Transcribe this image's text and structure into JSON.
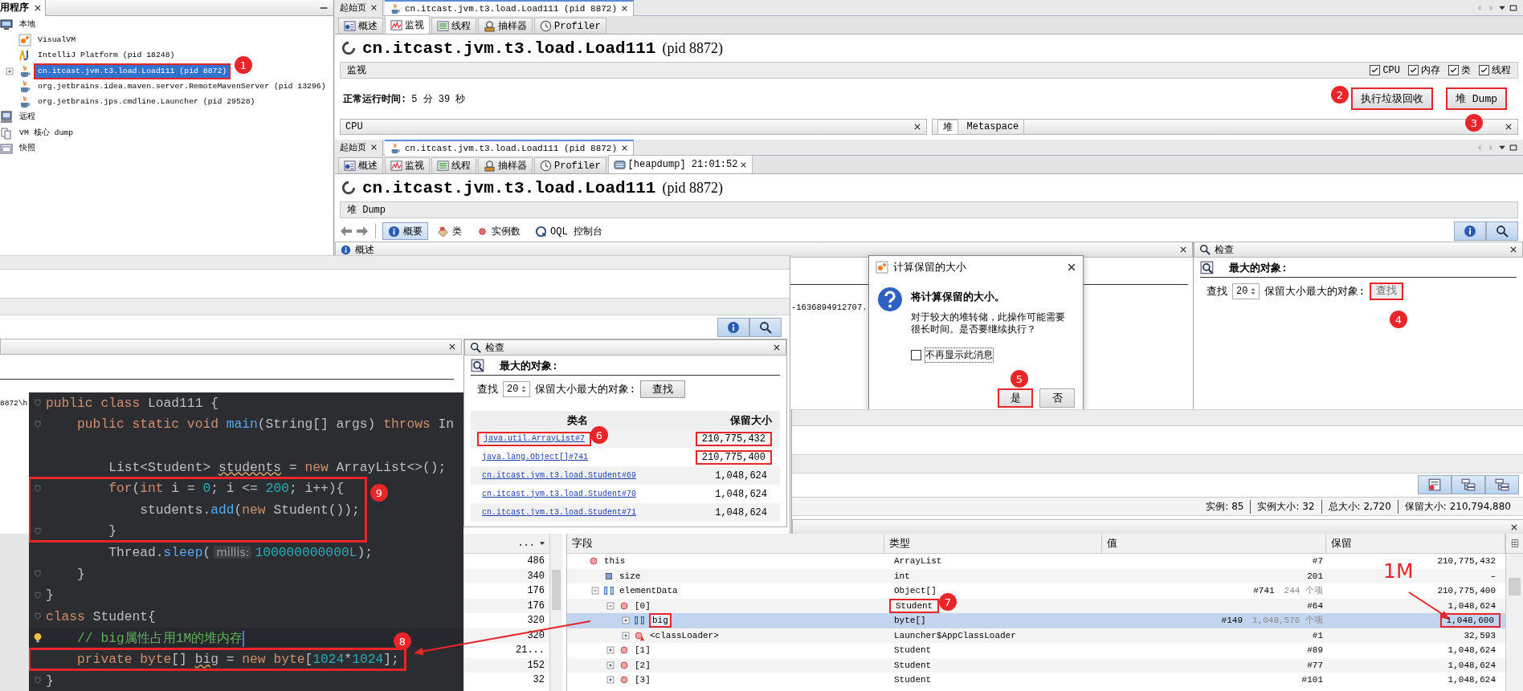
{
  "sidebar": {
    "title": "用程序",
    "items": [
      {
        "label": "本地",
        "selected": false,
        "children": [
          {
            "label": "VisualVM",
            "selected": false,
            "highlighted": false
          },
          {
            "label": "IntelliJ Platform (pid 18248)",
            "selected": false,
            "highlighted": false
          },
          {
            "label": "cn.itcast.jvm.t3.load.Load111 (pid 8872)",
            "selected": true,
            "highlighted": true,
            "expanded": false
          },
          {
            "label": "org.jetbrains.idea.maven.server.RemoteMavenServer (pid 13296)",
            "selected": false,
            "highlighted": false
          },
          {
            "label": "org.jetbrains.jps.cmdline.Launcher (pid 29528)",
            "selected": false,
            "highlighted": false
          }
        ]
      },
      {
        "label": "远程",
        "selected": false
      },
      {
        "label": "VM 核心 dump",
        "selected": false
      },
      {
        "label": "快照",
        "selected": false
      }
    ]
  },
  "monitor_window": {
    "doc_tabs": [
      {
        "label": "起始页",
        "selected": false
      },
      {
        "label": "cn.itcast.jvm.t3.load.Load111 (pid 8872)",
        "selected": true
      }
    ],
    "view_tabs": [
      {
        "label": "概述",
        "selected": false
      },
      {
        "label": "监视",
        "selected": true
      },
      {
        "label": "线程",
        "selected": false
      },
      {
        "label": "抽样器",
        "selected": false
      },
      {
        "label": "Profiler",
        "selected": false
      }
    ],
    "title": "cn.itcast.jvm.t3.load.Load111",
    "pid": "(pid 8872)",
    "section": "监视",
    "checkboxes": [
      {
        "label": "CPU",
        "checked": true
      },
      {
        "label": "内存",
        "checked": true
      },
      {
        "label": "类",
        "checked": true
      },
      {
        "label": "线程",
        "checked": true
      }
    ],
    "uptime_label": "正常运行时间:",
    "uptime": "5 分 39 秒",
    "buttons": [
      {
        "label": "执行垃圾回收",
        "highlighted": true
      },
      {
        "label": "堆 Dump",
        "highlighted": true
      }
    ],
    "cpu_panel": "CPU",
    "memory_tabs": [
      {
        "label": "堆",
        "selected": true
      },
      {
        "label": "Metaspace",
        "selected": false
      }
    ]
  },
  "heapdump_window": {
    "doc_tabs": [
      {
        "label": "起始页",
        "selected": false
      },
      {
        "label": "cn.itcast.jvm.t3.load.Load111 (pid 8872)",
        "selected": true
      }
    ],
    "view_tabs": [
      {
        "label": "概述",
        "selected": false,
        "closable": false
      },
      {
        "label": "监视",
        "selected": false,
        "closable": false
      },
      {
        "label": "线程",
        "selected": false,
        "closable": false
      },
      {
        "label": "抽样器",
        "selected": false,
        "closable": false
      },
      {
        "label": "Profiler",
        "selected": false,
        "closable": false
      },
      {
        "label": "[heapdump] 21:01:52",
        "selected": true,
        "closable": true
      }
    ],
    "title": "cn.itcast.jvm.t3.load.Load111",
    "pid": "(pid 8872)",
    "section": "堆 Dump",
    "toolbar": [
      {
        "label": "概要",
        "selected": true
      },
      {
        "label": "类",
        "selected": false
      },
      {
        "label": "实例数",
        "selected": false
      },
      {
        "label": "OQL 控制台",
        "selected": false
      }
    ],
    "overview_panel": "概述",
    "summary_value": "-1636894912707.",
    "inspect": {
      "title": "检查",
      "heading": "最大的对象:",
      "find_label": "查找",
      "count": "20",
      "suffix": "保留大小最大的对象:",
      "button": "查找",
      "button_disabled": true,
      "button_highlighted": true
    }
  },
  "classes_view": {
    "path_text": "8872\\h",
    "inspect": {
      "title": "检查",
      "heading": "最大的对象:",
      "find_label": "查找",
      "count": "20",
      "suffix": "保留大小最大的对象:",
      "button": "查找",
      "button_disabled": false,
      "button_highlighted": false,
      "columns": [
        "类名",
        "保留大小"
      ],
      "rows": [
        {
          "name": "java.util.ArrayList#7",
          "size": "210,775,432",
          "name_highlighted": true,
          "size_highlighted": true
        },
        {
          "name": "java.lang.Object[]#741",
          "size": "210,775,400",
          "name_highlighted": false,
          "size_highlighted": true
        },
        {
          "name": "cn.itcast.jvm.t3.load.Student#69",
          "size": "1,048,624",
          "name_highlighted": false,
          "size_highlighted": false
        },
        {
          "name": "cn.itcast.jvm.t3.load.Student#70",
          "size": "1,048,624",
          "name_highlighted": false,
          "size_highlighted": false
        },
        {
          "name": "cn.itcast.jvm.t3.load.Student#71",
          "size": "1,048,624",
          "name_highlighted": false,
          "size_highlighted": false
        }
      ]
    }
  },
  "dialog": {
    "title": "计算保留的大小",
    "heading": "将计算保留的大小。",
    "message": "对于较大的堆转储，此操作可能需要很长时间。是否要继续执行？",
    "checkbox": {
      "label": "不再显示此消息",
      "checked": false
    },
    "buttons": [
      {
        "label": "是",
        "default": true,
        "highlighted": true
      },
      {
        "label": "否",
        "default": false,
        "highlighted": false
      }
    ]
  },
  "instances_status": [
    "实例: 85",
    "实例大小: 32",
    "总大小: 2,720",
    "保留大小: 210,794,880"
  ],
  "line_numbers": {
    "header": "...",
    "values": [
      "486",
      "340",
      "176",
      "176",
      "320",
      "320",
      "21...",
      "152",
      "32"
    ]
  },
  "fields": {
    "columns": [
      "字段",
      "类型",
      "值",
      "保留"
    ],
    "rows": [
      {
        "name": "this",
        "kind": "object",
        "type": "ArrayList",
        "value": "#7",
        "retained": "210,775,432",
        "selected": false,
        "name_highlighted": false,
        "type_highlighted": false,
        "retained_highlighted": false,
        "children": [
          {
            "name": "size",
            "kind": "primitive",
            "type": "int",
            "value": "201",
            "retained": "–",
            "selected": false,
            "name_highlighted": false,
            "type_highlighted": false,
            "retained_highlighted": false
          },
          {
            "name": "elementData",
            "kind": "array",
            "type": "Object[]",
            "value": "#741",
            "count": "244 个项",
            "retained": "210,775,400",
            "selected": false,
            "expanded": true,
            "name_highlighted": false,
            "type_highlighted": false,
            "retained_highlighted": false,
            "children": [
              {
                "name": "[0]",
                "kind": "object",
                "type": "Student",
                "value": "#64",
                "retained": "1,048,624",
                "selected": false,
                "expanded": true,
                "name_highlighted": false,
                "type_highlighted": true,
                "retained_highlighted": false,
                "children": [
                  {
                    "name": "big",
                    "kind": "array",
                    "type": "byte[]",
                    "value": "#149",
                    "count": "1,048,576 个项",
                    "retained": "1,048,600",
                    "selected": true,
                    "expanded": false,
                    "name_highlighted": true,
                    "type_highlighted": false,
                    "retained_highlighted": true
                  },
                  {
                    "name": "<classLoader>",
                    "kind": "loader",
                    "type": "Launcher$AppClassLoader",
                    "value": "#1",
                    "retained": "32,593",
                    "selected": false,
                    "expanded": false,
                    "name_highlighted": false,
                    "type_highlighted": false,
                    "retained_highlighted": false
                  }
                ]
              },
              {
                "name": "[1]",
                "kind": "object",
                "type": "Student",
                "value": "#89",
                "retained": "1,048,624",
                "selected": false,
                "expanded": false,
                "name_highlighted": false,
                "type_highlighted": false,
                "retained_highlighted": false
              },
              {
                "name": "[2]",
                "kind": "object",
                "type": "Student",
                "value": "#77",
                "retained": "1,048,624",
                "selected": false,
                "expanded": false,
                "name_highlighted": false,
                "type_highlighted": false,
                "retained_highlighted": false
              },
              {
                "name": "[3]",
                "kind": "object",
                "type": "Student",
                "value": "#101",
                "retained": "1,048,624",
                "selected": false,
                "expanded": false,
                "name_highlighted": false,
                "type_highlighted": false,
                "retained_highlighted": false
              }
            ]
          }
        ]
      }
    ]
  },
  "code": {
    "lines": [
      {
        "fold": true,
        "framed": false,
        "tokens": [
          {
            "text": "public class ",
            "kind": "keyword"
          },
          {
            "text": "Load111 {",
            "kind": "plain"
          }
        ]
      },
      {
        "fold": true,
        "framed": false,
        "tokens": [
          {
            "text": "    public static void ",
            "kind": "keyword"
          },
          {
            "text": "main",
            "kind": "method"
          },
          {
            "text": "(String[] args) ",
            "kind": "plain"
          },
          {
            "text": "throws ",
            "kind": "keyword"
          },
          {
            "text": "In",
            "kind": "plain"
          }
        ]
      },
      {
        "fold": false,
        "framed": false
      },
      {
        "fold": false,
        "framed": false,
        "tokens": [
          {
            "text": "        List<Student> ",
            "kind": "plain"
          },
          {
            "text": "students",
            "kind": "warning"
          },
          {
            "text": " = ",
            "kind": "plain"
          },
          {
            "text": "new ",
            "kind": "keyword"
          },
          {
            "text": "ArrayList<>();",
            "kind": "plain"
          }
        ]
      },
      {
        "fold": true,
        "framed": true,
        "tokens": [
          {
            "text": "        for",
            "kind": "keyword"
          },
          {
            "text": "(",
            "kind": "plain"
          },
          {
            "text": "int ",
            "kind": "keyword"
          },
          {
            "text": "i = ",
            "kind": "plain"
          },
          {
            "text": "0",
            "kind": "number"
          },
          {
            "text": "; i <= ",
            "kind": "plain"
          },
          {
            "text": "200",
            "kind": "number"
          },
          {
            "text": "; i++){",
            "kind": "plain"
          }
        ]
      },
      {
        "fold": false,
        "framed": true,
        "tokens": [
          {
            "text": "            students.",
            "kind": "plain"
          },
          {
            "text": "add",
            "kind": "method"
          },
          {
            "text": "(",
            "kind": "plain"
          },
          {
            "text": "new ",
            "kind": "keyword"
          },
          {
            "text": "Student());",
            "kind": "plain"
          }
        ]
      },
      {
        "fold": true,
        "framed": true,
        "tokens": [
          {
            "text": "        }",
            "kind": "plain"
          }
        ]
      },
      {
        "fold": false,
        "framed": false,
        "tokens": [
          {
            "text": "        Thread.",
            "kind": "plain"
          },
          {
            "text": "sleep",
            "kind": "method"
          },
          {
            "text": "(",
            "kind": "plain"
          },
          {
            "text": "millis:",
            "kind": "hint"
          },
          {
            "text": "100000000000L",
            "kind": "number"
          },
          {
            "text": ");",
            "kind": "plain"
          }
        ]
      },
      {
        "fold": true,
        "framed": false,
        "tokens": [
          {
            "text": "    }",
            "kind": "plain"
          }
        ]
      },
      {
        "fold": true,
        "framed": false,
        "tokens": [
          {
            "text": "}",
            "kind": "plain"
          }
        ]
      },
      {
        "fold": true,
        "framed": false,
        "tokens": [
          {
            "text": "class ",
            "kind": "keyword"
          },
          {
            "text": "Student{",
            "kind": "plain"
          }
        ]
      },
      {
        "fold": false,
        "framed": false,
        "bulb": true,
        "caret": true,
        "tokens": [
          {
            "text": "    // big属性占用1M的堆内存",
            "kind": "comment"
          }
        ]
      },
      {
        "fold": false,
        "framed": true,
        "tokens": [
          {
            "text": "    private ",
            "kind": "keyword"
          },
          {
            "text": "byte",
            "kind": "keyword"
          },
          {
            "text": "[] ",
            "kind": "plain"
          },
          {
            "text": "big",
            "kind": "warning"
          },
          {
            "text": " = ",
            "kind": "plain"
          },
          {
            "text": "new ",
            "kind": "keyword"
          },
          {
            "text": "byte",
            "kind": "keyword"
          },
          {
            "text": "[",
            "kind": "plain"
          },
          {
            "text": "1024",
            "kind": "number"
          },
          {
            "text": "*",
            "kind": "plain"
          },
          {
            "text": "1024",
            "kind": "number"
          },
          {
            "text": "];",
            "kind": "plain"
          }
        ]
      },
      {
        "fold": true,
        "framed": false,
        "tokens": [
          {
            "text": "}",
            "kind": "plain"
          }
        ]
      }
    ]
  },
  "annotations": {
    "steps": [
      "1",
      "2",
      "3",
      "4",
      "5",
      "6",
      "7",
      "8",
      "9"
    ],
    "note": "1M"
  }
}
